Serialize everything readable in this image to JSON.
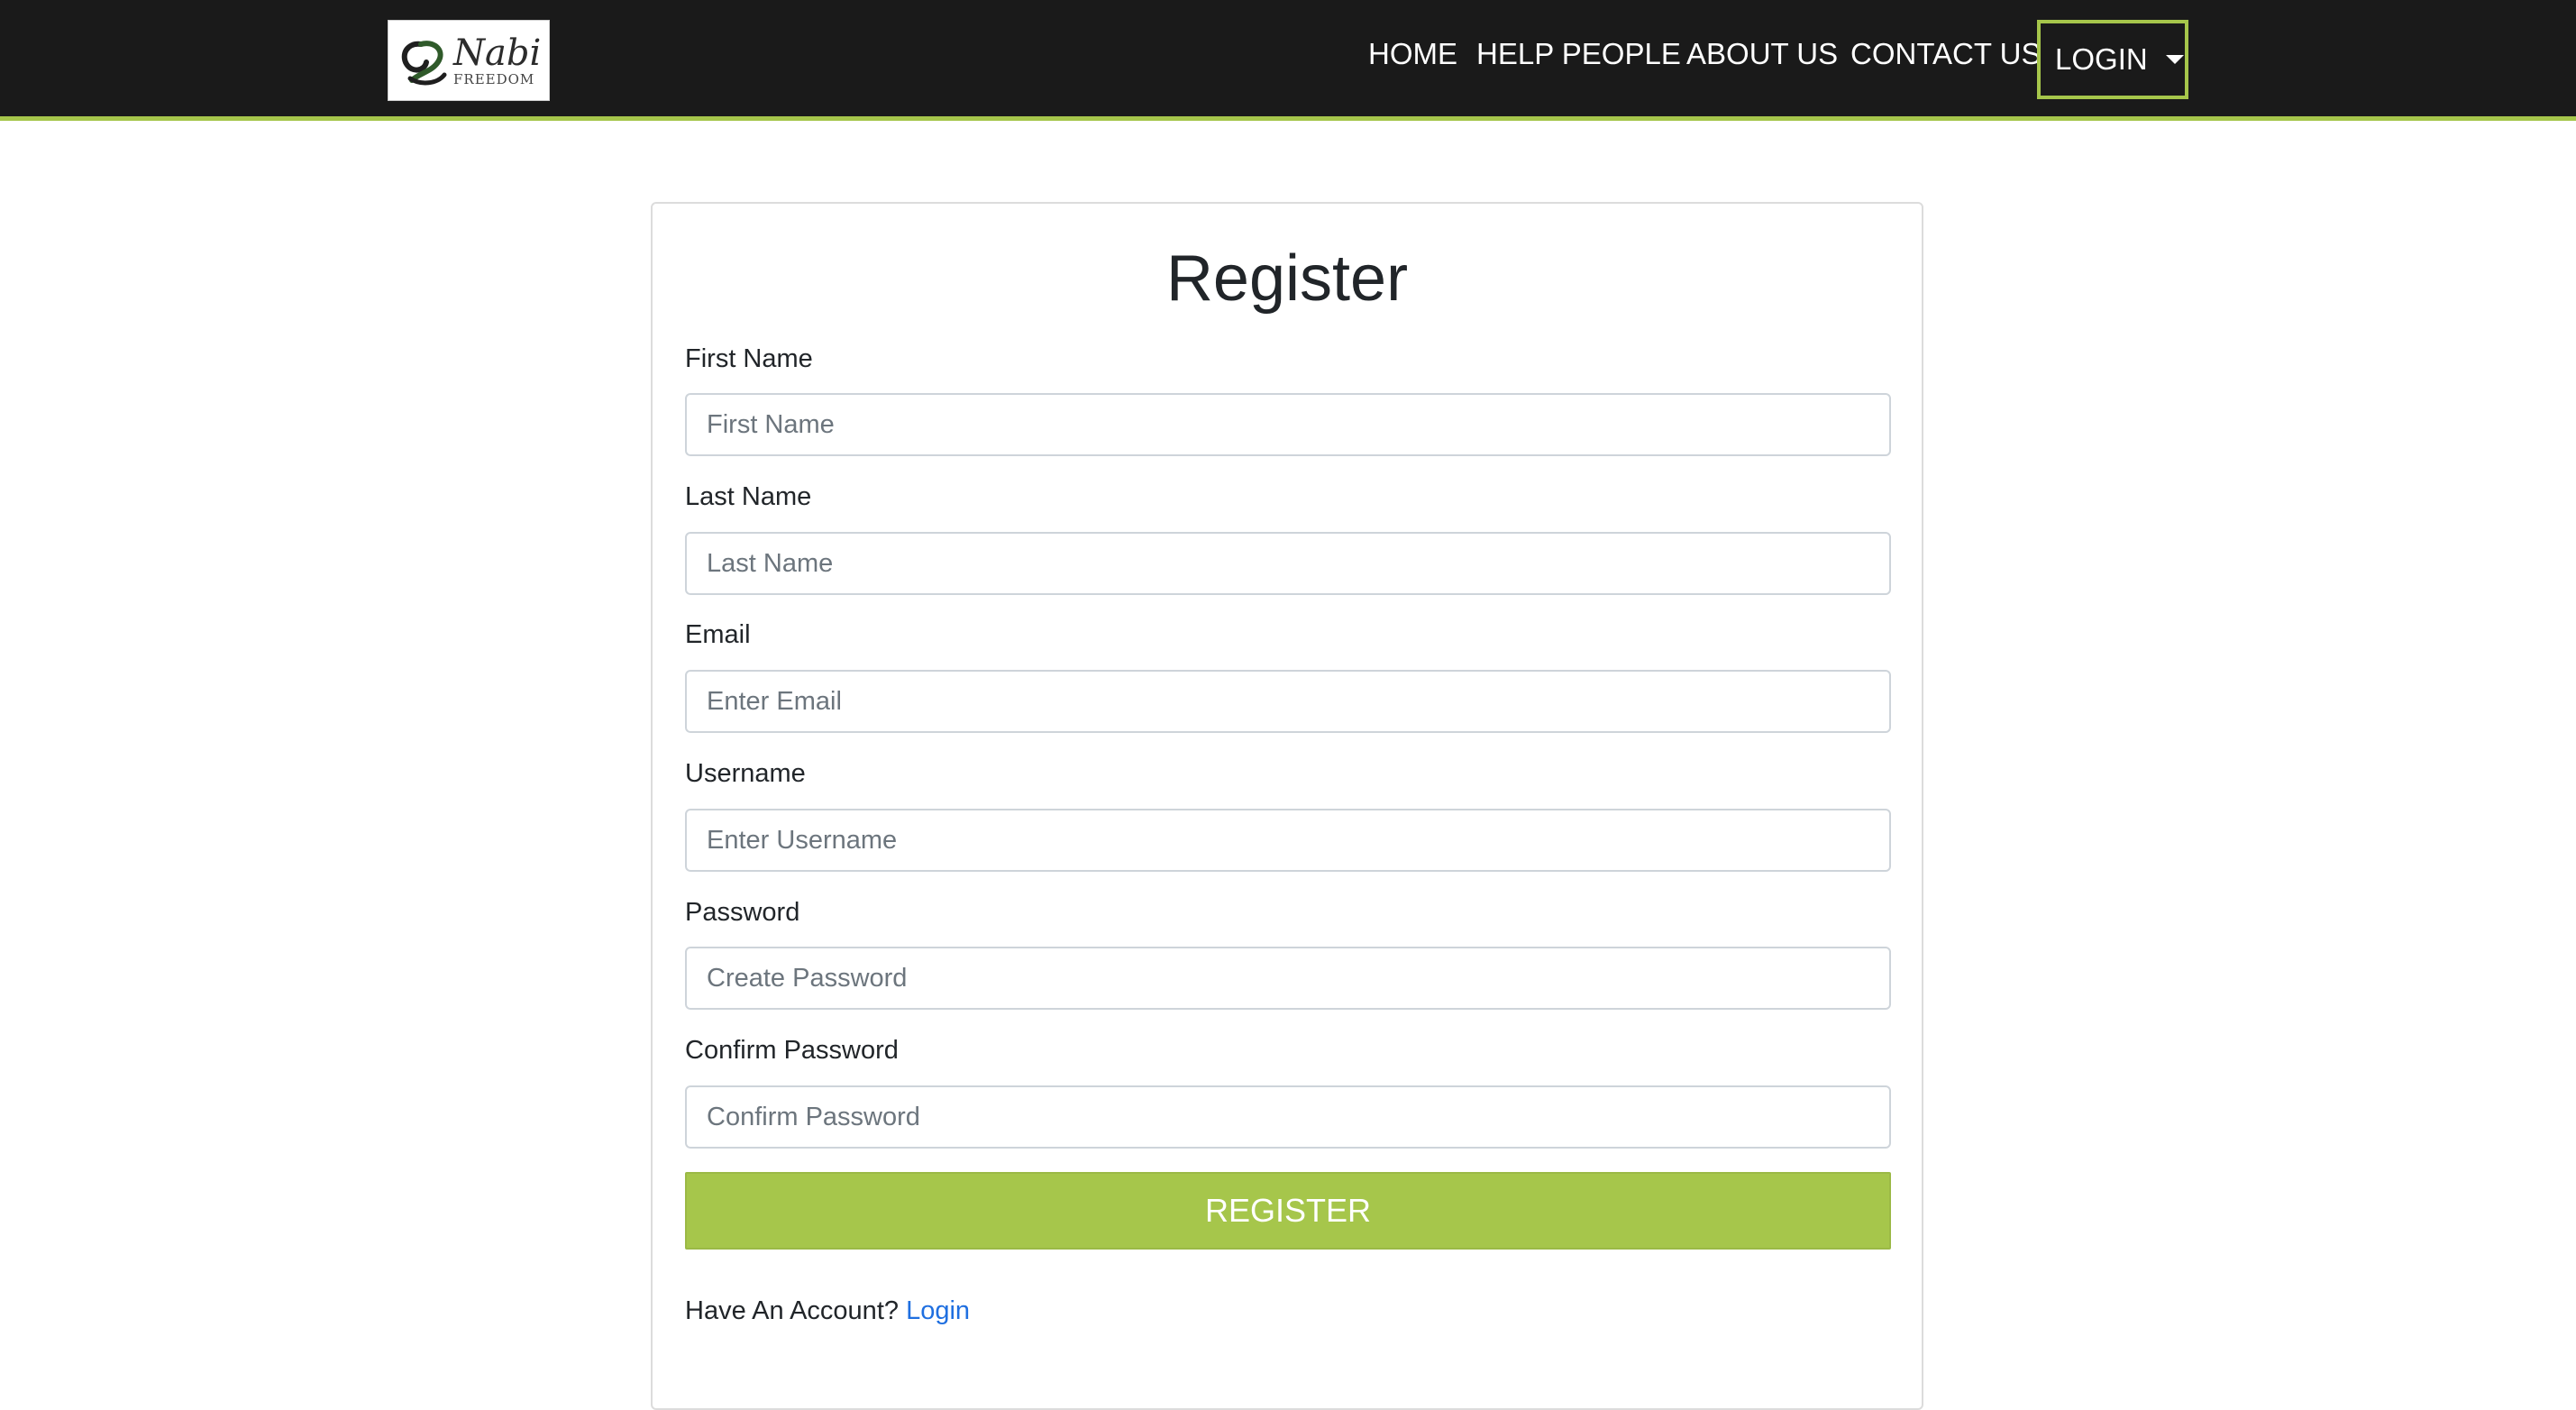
{
  "brand": {
    "logo_word": "Nabi",
    "logo_sub": "FREEDOM",
    "accent_color": "#a6c64b",
    "navbar_color": "#1a1a1a",
    "link_color": "#1f6fe0"
  },
  "nav": {
    "items": [
      {
        "label": "HOME"
      },
      {
        "label": "HELP PEOPLE"
      },
      {
        "label": "ABOUT US"
      },
      {
        "label": "CONTACT US"
      }
    ],
    "login_dropdown": {
      "label": "LOGIN",
      "icon": "caret-down-icon"
    }
  },
  "form": {
    "title": "Register",
    "fields": [
      {
        "label": "First Name",
        "placeholder": "First Name",
        "value": ""
      },
      {
        "label": "Last Name",
        "placeholder": "Last Name",
        "value": ""
      },
      {
        "label": "Email",
        "placeholder": "Enter Email",
        "value": ""
      },
      {
        "label": "Username",
        "placeholder": "Enter Username",
        "value": ""
      },
      {
        "label": "Password",
        "placeholder": "Create Password",
        "value": ""
      },
      {
        "label": "Confirm Password",
        "placeholder": "Confirm Password",
        "value": ""
      }
    ],
    "submit_label": "REGISTER",
    "account_prompt": "Have An Account?",
    "login_link": "Login"
  }
}
